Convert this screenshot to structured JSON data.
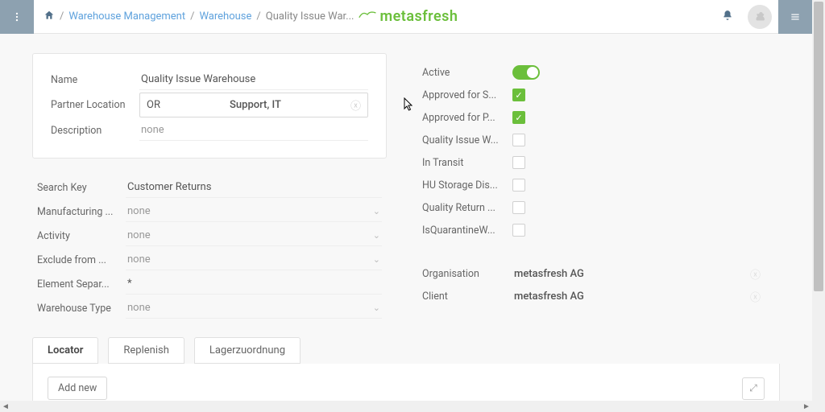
{
  "breadcrumb": {
    "segments": [
      "Warehouse Management",
      "Warehouse"
    ],
    "current": "Quality Issue War..."
  },
  "brand": "metasfresh",
  "left_panel1": {
    "name_label": "Name",
    "name_value": "Quality Issue Warehouse",
    "partner_label": "Partner Location",
    "partner_code": "OR",
    "partner_value": "Support, IT",
    "desc_label": "Description",
    "desc_value": "none"
  },
  "left_panel2": {
    "search_label": "Search Key",
    "search_value": "Customer Returns",
    "mfg_label": "Manufacturing ...",
    "mfg_value": "none",
    "activity_label": "Activity",
    "activity_value": "none",
    "exclude_label": "Exclude from ...",
    "exclude_value": "none",
    "sep_label": "Element Separ...",
    "sep_value": "*",
    "wtype_label": "Warehouse Type",
    "wtype_value": "none"
  },
  "flags": {
    "active_label": "Active",
    "approved_s_label": "Approved for S...",
    "approved_p_label": "Approved for P...",
    "quality_w_label": "Quality Issue W...",
    "transit_label": "In Transit",
    "hu_label": "HU Storage Dis...",
    "qreturn_label": "Quality Return ...",
    "quarantine_label": "IsQuarantineW..."
  },
  "orgclient": {
    "org_label": "Organisation",
    "org_value": "metasfresh AG",
    "client_label": "Client",
    "client_value": "metasfresh AG"
  },
  "tabs": {
    "t1": "Locator",
    "t2": "Replenish",
    "t3": "Lagerzuordnung",
    "add": "Add new"
  }
}
